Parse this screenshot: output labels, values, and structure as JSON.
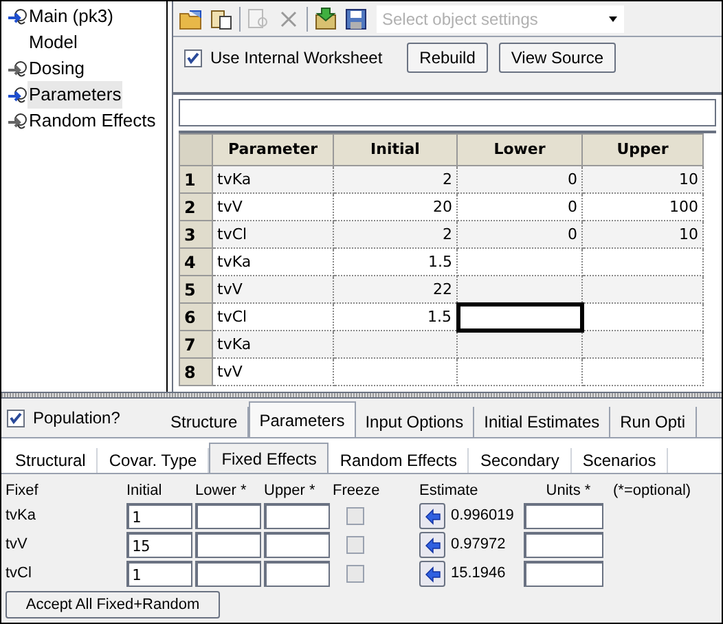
{
  "tree": {
    "items": [
      {
        "label": "Main (pk3)",
        "kind": "linked",
        "selected": false
      },
      {
        "label": "Model",
        "kind": "plain",
        "selected": false
      },
      {
        "label": "Dosing",
        "kind": "unlinked",
        "selected": false
      },
      {
        "label": "Parameters",
        "kind": "linked",
        "selected": true
      },
      {
        "label": "Random Effects",
        "kind": "unlinked",
        "selected": false
      }
    ]
  },
  "toolbar": {
    "dropdown": {
      "placeholder": "Select object settings"
    }
  },
  "worksheet": {
    "use_internal": {
      "label": "Use Internal Worksheet",
      "checked": true
    },
    "buttons": [
      "Rebuild",
      "View Source"
    ]
  },
  "grid": {
    "columns": [
      "Parameter",
      "Initial",
      "Lower",
      "Upper"
    ],
    "rows": [
      {
        "number": "1",
        "cells": [
          {
            "value": "tvKa",
            "selected": false
          },
          {
            "value": "2",
            "selected": false
          },
          {
            "value": "0",
            "selected": false
          },
          {
            "value": "10",
            "selected": false
          }
        ]
      },
      {
        "number": "2",
        "cells": [
          {
            "value": "tvV",
            "selected": false
          },
          {
            "value": "20",
            "selected": false
          },
          {
            "value": "0",
            "selected": false
          },
          {
            "value": "100",
            "selected": false
          }
        ]
      },
      {
        "number": "3",
        "cells": [
          {
            "value": "tvCl",
            "selected": false
          },
          {
            "value": "2",
            "selected": false
          },
          {
            "value": "0",
            "selected": false
          },
          {
            "value": "10",
            "selected": false
          }
        ]
      },
      {
        "number": "4",
        "cells": [
          {
            "value": "tvKa",
            "selected": false
          },
          {
            "value": "1.5",
            "selected": false
          },
          {
            "selected": false
          },
          {
            "selected": false
          }
        ]
      },
      {
        "number": "5",
        "cells": [
          {
            "value": "tvV",
            "selected": false
          },
          {
            "value": "22",
            "selected": false
          },
          {
            "selected": false
          },
          {
            "selected": false
          }
        ]
      },
      {
        "number": "6",
        "cells": [
          {
            "value": "tvCl",
            "selected": false
          },
          {
            "value": "1.5",
            "selected": false
          },
          {
            "selected": true
          },
          {
            "selected": false
          }
        ]
      },
      {
        "number": "7",
        "cells": [
          {
            "value": "tvKa",
            "selected": false
          },
          {
            "selected": false
          },
          {
            "selected": false
          },
          {
            "selected": false
          }
        ]
      },
      {
        "number": "8",
        "cells": [
          {
            "value": "tvV",
            "selected": false
          },
          {
            "selected": false
          },
          {
            "selected": false
          },
          {
            "selected": false
          }
        ]
      }
    ]
  },
  "population": {
    "label": "Population?",
    "checked": true
  },
  "tabs": [
    {
      "label": "Structure",
      "selected": false
    },
    {
      "label": "Parameters",
      "selected": true
    },
    {
      "label": "Input Options",
      "selected": false
    },
    {
      "label": "Initial Estimates",
      "selected": false
    },
    {
      "label": "Run Opti",
      "selected": false
    }
  ],
  "subtabs": [
    {
      "label": "Structural",
      "selected": false
    },
    {
      "label": "Covar. Type",
      "selected": false
    },
    {
      "label": "Fixed Effects",
      "selected": true
    },
    {
      "label": "Random Effects",
      "selected": false
    },
    {
      "label": "Secondary",
      "selected": false
    },
    {
      "label": "Scenarios",
      "selected": false
    }
  ],
  "fixef": {
    "headers": [
      "Fixef",
      "Initial",
      "Lower *",
      "Upper *",
      "Freeze",
      "Estimate",
      "Units *",
      "(*=optional)"
    ],
    "rows": [
      {
        "name": "tvKa",
        "initial": "1",
        "freeze": false,
        "estimate": "0.996019"
      },
      {
        "name": "tvV",
        "initial": "15",
        "freeze": false,
        "estimate": "0.97972"
      },
      {
        "name": "tvCl",
        "initial": "1",
        "freeze": false,
        "estimate": "15.1946"
      }
    ]
  },
  "accept_button": "Accept All Fixed+Random"
}
